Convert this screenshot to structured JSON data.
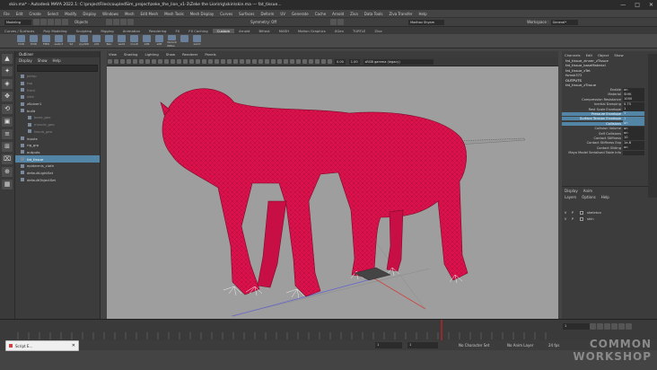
{
  "window": {
    "title": "skin.ma* - Autodesk MAYA 2022.1: C:\\projectFiles\\coupledSim_project\\zeke_the_lion_v1-3\\Zeke the Lion\\rig\\skin\\skin.ma  ---  fat_tissue...",
    "controls": [
      "—",
      "□",
      "✕"
    ]
  },
  "menubar": [
    "File",
    "Edit",
    "Create",
    "Select",
    "Modify",
    "Display",
    "Windows",
    "Mesh",
    "Edit Mesh",
    "Mesh Tools",
    "Mesh Display",
    "Curves",
    "Surfaces",
    "Deform",
    "UV",
    "Generate",
    "Cache",
    "Arnold",
    "Ziva",
    "Data Tools",
    "Ziva Transfer",
    "Help"
  ],
  "status": {
    "mode": "Modeling",
    "objects": "Objects",
    "symmetry": "Symmetry: Off",
    "user": "Madhav Shyam",
    "workspace_label": "Workspace :",
    "workspace_value": "General*"
  },
  "shelf_tabs": [
    "Curves / Surfaces",
    "Poly Modeling",
    "Sculpting",
    "Rigging",
    "Animation",
    "Rendering",
    "FX",
    "FX Caching",
    "Custom",
    "Arnold",
    "Bifrost",
    "MASH",
    "Motion Graphics",
    "XGen",
    "TURTLE",
    "Ziva"
  ],
  "shelf_tabs_active": 8,
  "shelf_icons": [
    "CVW",
    "PVW",
    "FMW",
    "sw2n7",
    "SX",
    "cpyWW",
    "xtrt",
    "Ban",
    "ws01",
    "mns8",
    "z2N",
    "s0ft",
    "rSmsnt rtMan",
    "",
    "zeCrt"
  ],
  "tools": [
    "▲",
    "✦",
    "◈",
    "✥",
    "⟲",
    "▣",
    "≡",
    "⊞",
    "⌧",
    "⊕",
    "▦"
  ],
  "outliner": {
    "title": "Outliner",
    "menus": [
      "Display",
      "Show",
      "Help"
    ],
    "items": [
      {
        "label": "persp",
        "dim": true
      },
      {
        "label": "top",
        "dim": true
      },
      {
        "label": "front",
        "dim": true
      },
      {
        "label": "side",
        "dim": true
      },
      {
        "label": "zSolver1",
        "dim": false
      },
      {
        "label": "build",
        "dim": false
      },
      {
        "label": "bone_geo",
        "dim": true
      },
      {
        "label": "muscle_geo",
        "dim": true
      },
      {
        "label": "fascia_geo",
        "dim": true
      },
      {
        "label": "inputs",
        "dim": false
      },
      {
        "label": "rig_grp",
        "dim": false
      },
      {
        "label": "outputs",
        "dim": false
      },
      {
        "label": "fat_tissue",
        "dim": false,
        "selected": true
      },
      {
        "label": "epidermis_cloth",
        "dim": false
      },
      {
        "label": "defaultLightSet",
        "dim": false
      },
      {
        "label": "defaultObjectSet",
        "dim": false
      }
    ]
  },
  "viewport": {
    "menus": [
      "View",
      "Shading",
      "Lighting",
      "Show",
      "Renderer",
      "Panels"
    ],
    "field1": "0.00",
    "field2": "1.00",
    "colorspace": "sRGB gamma (legacy)"
  },
  "channelbox": {
    "tabs": [
      "Channels",
      "Edit",
      "Object",
      "Show"
    ],
    "header_nodes": [
      "fat_tissue_zinner_zTissue",
      "fat_tissue_baseMaterial",
      "fat_tissue_zTet",
      "fsmsk372"
    ],
    "outputs_label": "OUTPUTS",
    "output_node": "fat_tissue_zTissue",
    "attrs": [
      {
        "k": "Enable",
        "v": "on"
      },
      {
        "k": "Material",
        "v": "StVK"
      },
      {
        "k": "Compression Resistance",
        "v": "1000"
      },
      {
        "k": "Inertial Damping",
        "v": "0.75"
      },
      {
        "k": "Rest Scale Envelope",
        "v": "1"
      },
      {
        "k": "Pressure Envelope",
        "v": "1",
        "hl": true
      },
      {
        "k": "Surface Tension Envelope",
        "v": "1",
        "hl": true
      },
      {
        "k": "Collisions",
        "v": "on",
        "hl": true
      },
      {
        "k": "Collision Volume",
        "v": "on"
      },
      {
        "k": "Self Collisions",
        "v": "on"
      },
      {
        "k": "Contact Stiffness",
        "v": "10"
      },
      {
        "k": "Contact Stiffness Exp",
        "v": "1e-6"
      },
      {
        "k": "Contact Sliding",
        "v": "on"
      },
      {
        "k": "Maya Model Serialised Table Info",
        "v": ""
      }
    ]
  },
  "layers": {
    "tabs": [
      "Display",
      "Anim"
    ],
    "menus": [
      "Layers",
      "Options",
      "Help"
    ],
    "rows": [
      {
        "v": "V",
        "p": "P",
        "name": "skeleton"
      },
      {
        "v": "V",
        "p": "P",
        "name": "skin"
      }
    ]
  },
  "time": {
    "current": "1",
    "start": "1",
    "end": "1",
    "character_set": "No Character Set",
    "anim_layer": "No Anim Layer",
    "fps": "24 fps"
  },
  "script_editor_button": "Script E...",
  "watermark": {
    "line1": "COMMON",
    "line2": "WORKSHOP"
  },
  "colors": {
    "mesh": "#e0114d",
    "mesh_wire": "#8e0e31",
    "viewport_bg": "#9e9e9e",
    "selection": "#5285a6"
  }
}
